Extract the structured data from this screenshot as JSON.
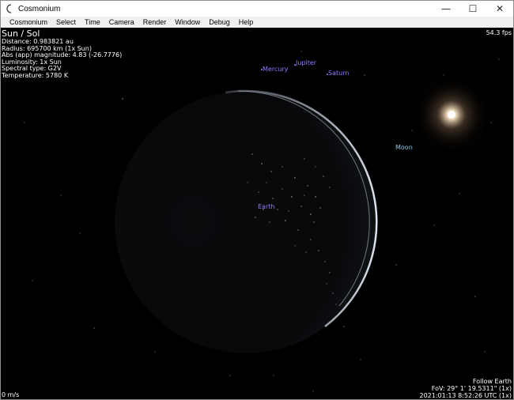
{
  "window": {
    "title": "Cosmonium",
    "minimize_glyph": "—",
    "maximize_glyph": "☐",
    "close_glyph": "✕"
  },
  "menu": {
    "items": [
      {
        "label": "Cosmonium"
      },
      {
        "label": "Select"
      },
      {
        "label": "Time"
      },
      {
        "label": "Camera"
      },
      {
        "label": "Render"
      },
      {
        "label": "Window"
      },
      {
        "label": "Debug"
      },
      {
        "label": "Help"
      }
    ]
  },
  "info": {
    "name": "Sun / Sol",
    "distance": "Distance: 0.983821 au",
    "radius": "Radius: 695700 km (1x Sun)",
    "magnitude": "Abs (app) magnitude: 4.83 (-26.7776)",
    "luminosity": "Luminosity: 1x Sun",
    "spectral": "Spectral type: G2V",
    "temperature": "Temperature: 5780 K"
  },
  "fps": "54.3 fps",
  "labels": {
    "mercury": "Mercury",
    "jupiter": "Jupiter",
    "saturn": "Saturn",
    "moon": "Moon",
    "earth": "Earth"
  },
  "status": {
    "speed": "0 m/s",
    "follow": "Follow Earth",
    "fov": "FoV: 29° 1' 19.5311\" (1x)",
    "datetime": "2021:01:13  8:52:26 UTC (1x)"
  },
  "colors": {
    "planet_label": "#8a7bff",
    "moon_label": "#8fc4e8",
    "background": "#000000",
    "menubar": "#f0f0f0"
  }
}
